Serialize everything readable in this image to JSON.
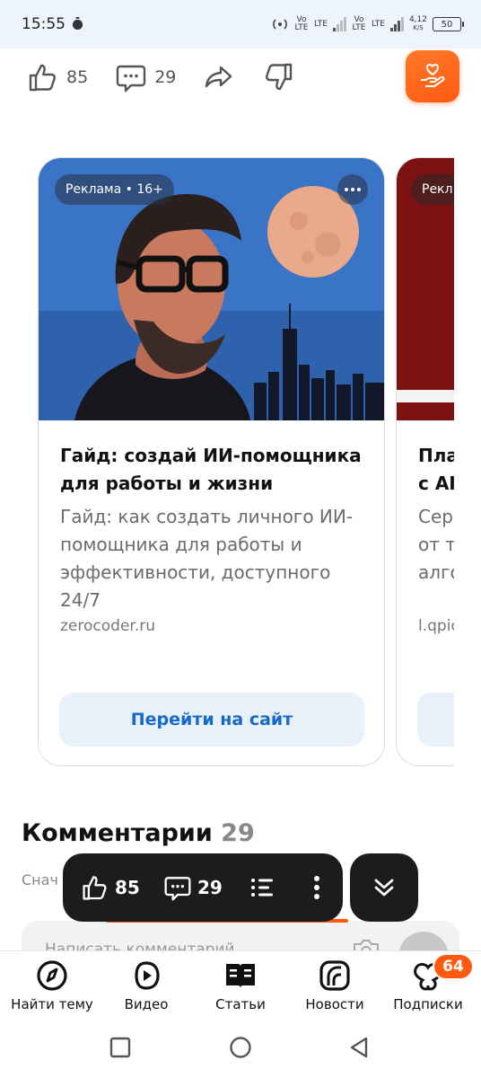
{
  "status_bar": {
    "time": "15:55",
    "net1": "Vo LTE",
    "net2": "LTE",
    "net3": "Vo LTE",
    "net4": "LTE",
    "speed": "4,12",
    "speed_unit": "K/S",
    "battery": "50"
  },
  "reactions": {
    "likes": "85",
    "comments": "29"
  },
  "ads": [
    {
      "badge": "Реклама • 16+",
      "title": "Гайд: создай ИИ-помощника для работы и жизни",
      "description": "Гайд: как создать личного ИИ-помощника для работы и эффективности, доступного 24/7",
      "domain": "zerocoder.ru",
      "cta": "Перейти на сайт"
    },
    {
      "badge": "Рекл",
      "title_line1": "Пла",
      "title_line2": "с AI-",
      "desc_line1": "Сер",
      "desc_line2": "от т",
      "desc_line3": "алго",
      "domain": "l.qpic"
    }
  ],
  "comments": {
    "heading": "Комментарии",
    "count": "29",
    "sort": "Снач",
    "input_placeholder": "Написать комментарий"
  },
  "floating_bar": {
    "likes": "85",
    "comments": "29"
  },
  "bottom_nav": [
    {
      "label": "Найти тему",
      "icon": "compass-icon"
    },
    {
      "label": "Видео",
      "icon": "play-icon"
    },
    {
      "label": "Статьи",
      "icon": "book-icon"
    },
    {
      "label": "Новости",
      "icon": "news-icon"
    },
    {
      "label": "Подписки",
      "icon": "subscriptions-icon",
      "badge": "64"
    }
  ],
  "colors": {
    "accent": "#ff5a10",
    "link": "#1769c8",
    "dark_pill": "#1c1c1c"
  }
}
